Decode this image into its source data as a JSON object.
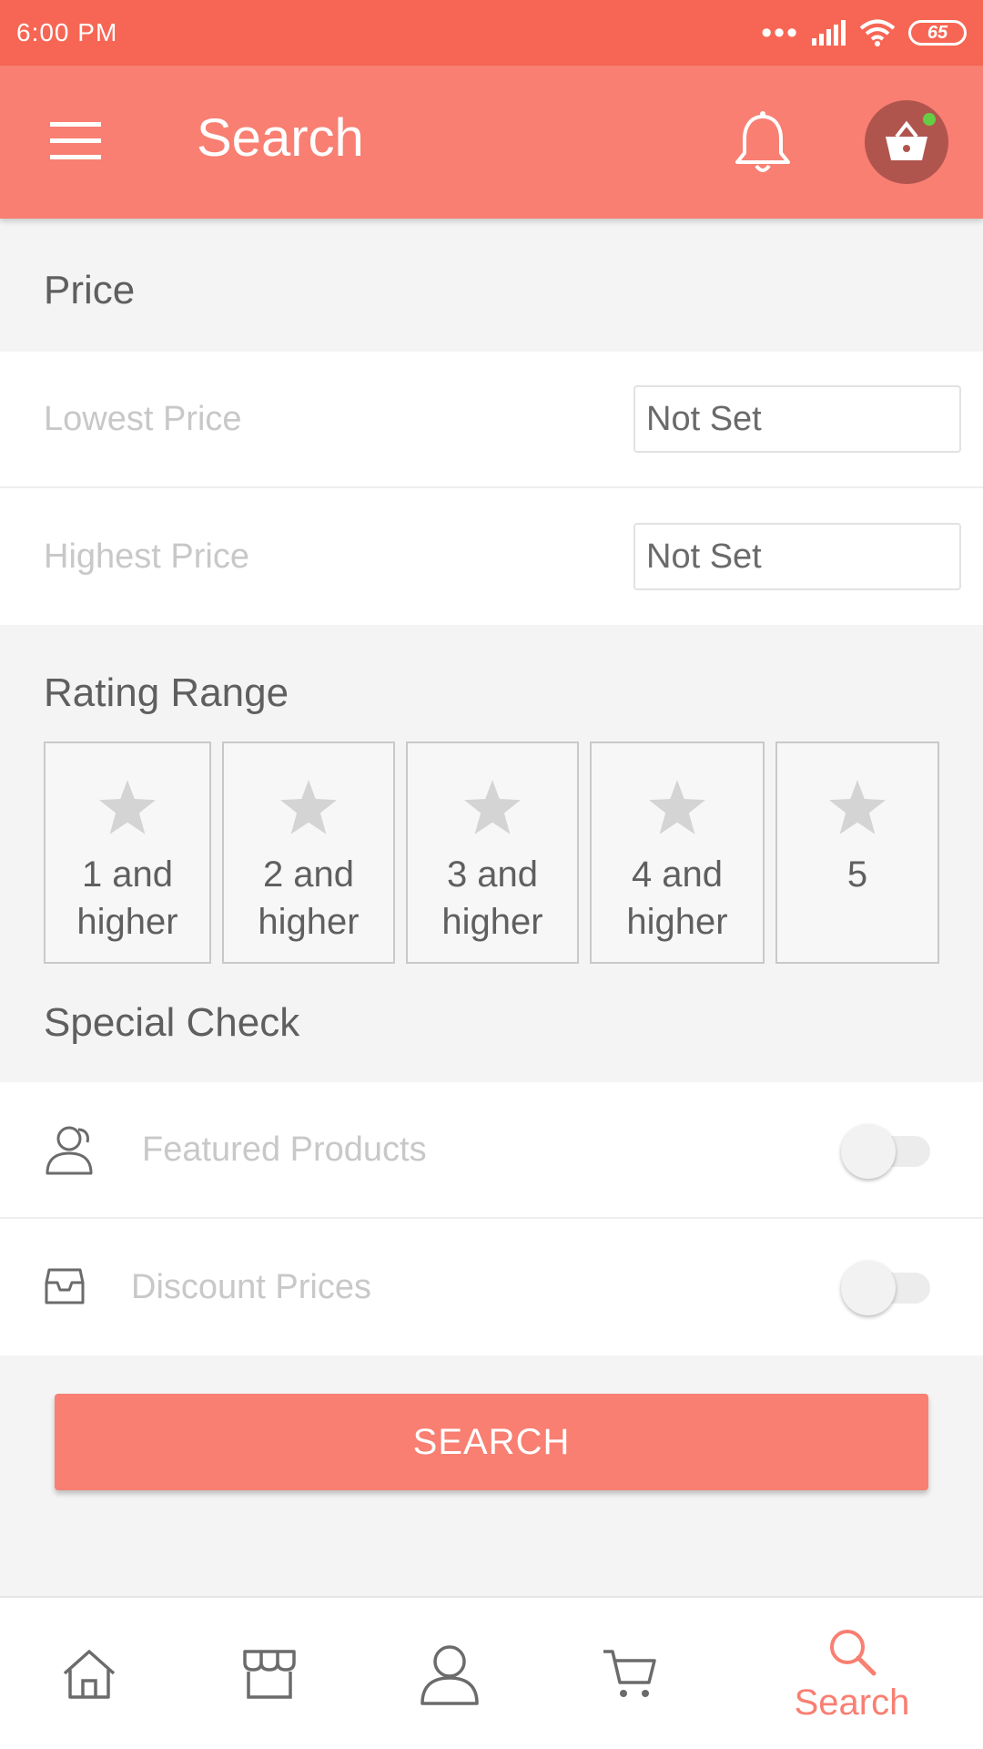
{
  "status_bar": {
    "time": "6:00 PM",
    "signal_dots": "•••",
    "battery": "65"
  },
  "app_bar": {
    "title": "Search",
    "menu_icon": "hamburger-menu-icon",
    "notification_icon": "bell-icon",
    "cart_icon": "shopping-basket-icon",
    "cart_indicator_color": "#66cc44"
  },
  "price_section": {
    "label": "Price",
    "rows": [
      {
        "label": "Lowest Price",
        "value": "Not Set"
      },
      {
        "label": "Highest Price",
        "value": "Not Set"
      }
    ]
  },
  "rating_section": {
    "label": "Rating Range",
    "options": [
      {
        "line1": "1 and",
        "line2": "higher"
      },
      {
        "line1": "2 and",
        "line2": "higher"
      },
      {
        "line1": "3 and",
        "line2": "higher"
      },
      {
        "line1": "4 and",
        "line2": "higher"
      },
      {
        "line1": "5",
        "line2": ""
      }
    ]
  },
  "special_section": {
    "label": "Special Check",
    "rows": [
      {
        "icon": "users-icon",
        "label": "Featured Products",
        "enabled": false
      },
      {
        "icon": "inbox-icon",
        "label": "Discount Prices",
        "enabled": false
      }
    ]
  },
  "search_button": {
    "label": "SEARCH"
  },
  "bottom_nav": {
    "items": [
      {
        "icon": "home-icon",
        "label": ""
      },
      {
        "icon": "store-icon",
        "label": ""
      },
      {
        "icon": "profile-icon",
        "label": ""
      },
      {
        "icon": "cart-icon",
        "label": ""
      },
      {
        "icon": "search-icon",
        "label": "Search",
        "active": true
      }
    ]
  },
  "colors": {
    "status_bar": "#f76654",
    "accent": "#f87f72",
    "cart_fab": "#b0554e",
    "background": "#f4f4f4"
  }
}
